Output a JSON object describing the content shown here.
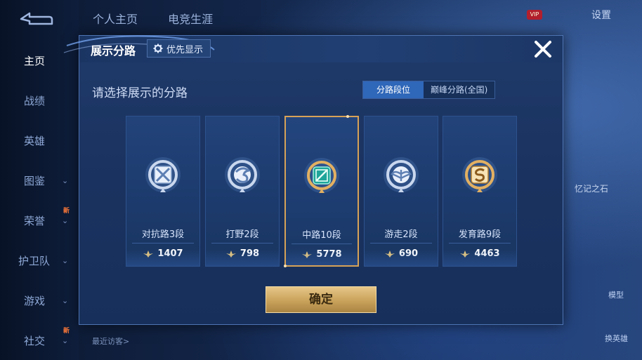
{
  "background": {
    "top_tabs": [
      "个人主页",
      "电竞生涯"
    ],
    "settings_label": "设置",
    "vip_label": "VIP",
    "visitors_label": "最近访客>",
    "bg_text": "忆记之石",
    "right_button_1": "模型",
    "right_button_2": "换英雄"
  },
  "sidebar": {
    "items": [
      {
        "label": "主页",
        "has_arrow": false,
        "new": false
      },
      {
        "label": "战绩",
        "has_arrow": false,
        "new": false
      },
      {
        "label": "英雄",
        "has_arrow": false,
        "new": false
      },
      {
        "label": "图鉴",
        "has_arrow": true,
        "new": false
      },
      {
        "label": "荣誉",
        "has_arrow": true,
        "new": true
      },
      {
        "label": "护卫队",
        "has_arrow": true,
        "new": false
      },
      {
        "label": "游戏",
        "has_arrow": true,
        "new": false
      },
      {
        "label": "社交",
        "has_arrow": true,
        "new": true
      }
    ],
    "new_badge": "新"
  },
  "modal": {
    "title": "展示分路",
    "priority_label": "优先显示",
    "subtitle": "请选择展示的分路",
    "segments": {
      "active": "分路段位",
      "inactive": "巅峰分路(全国)"
    },
    "confirm_label": "确定",
    "cards": [
      {
        "name": "对抗路3段",
        "score": "1407",
        "emblem": "crossed-swords-emblem",
        "selected": false
      },
      {
        "name": "打野2段",
        "score": "798",
        "emblem": "dragon-emblem",
        "selected": false
      },
      {
        "name": "中路10段",
        "score": "5778",
        "emblem": "gem-staff-emblem",
        "selected": true
      },
      {
        "name": "游走2段",
        "score": "690",
        "emblem": "wings-emblem",
        "selected": false
      },
      {
        "name": "发育路9段",
        "score": "4463",
        "emblem": "bow-emblem",
        "selected": false
      }
    ]
  },
  "colors": {
    "accent_gold": "#d7a257",
    "segment_active": "#2f67b9",
    "modal_bg": "#1a325f"
  }
}
